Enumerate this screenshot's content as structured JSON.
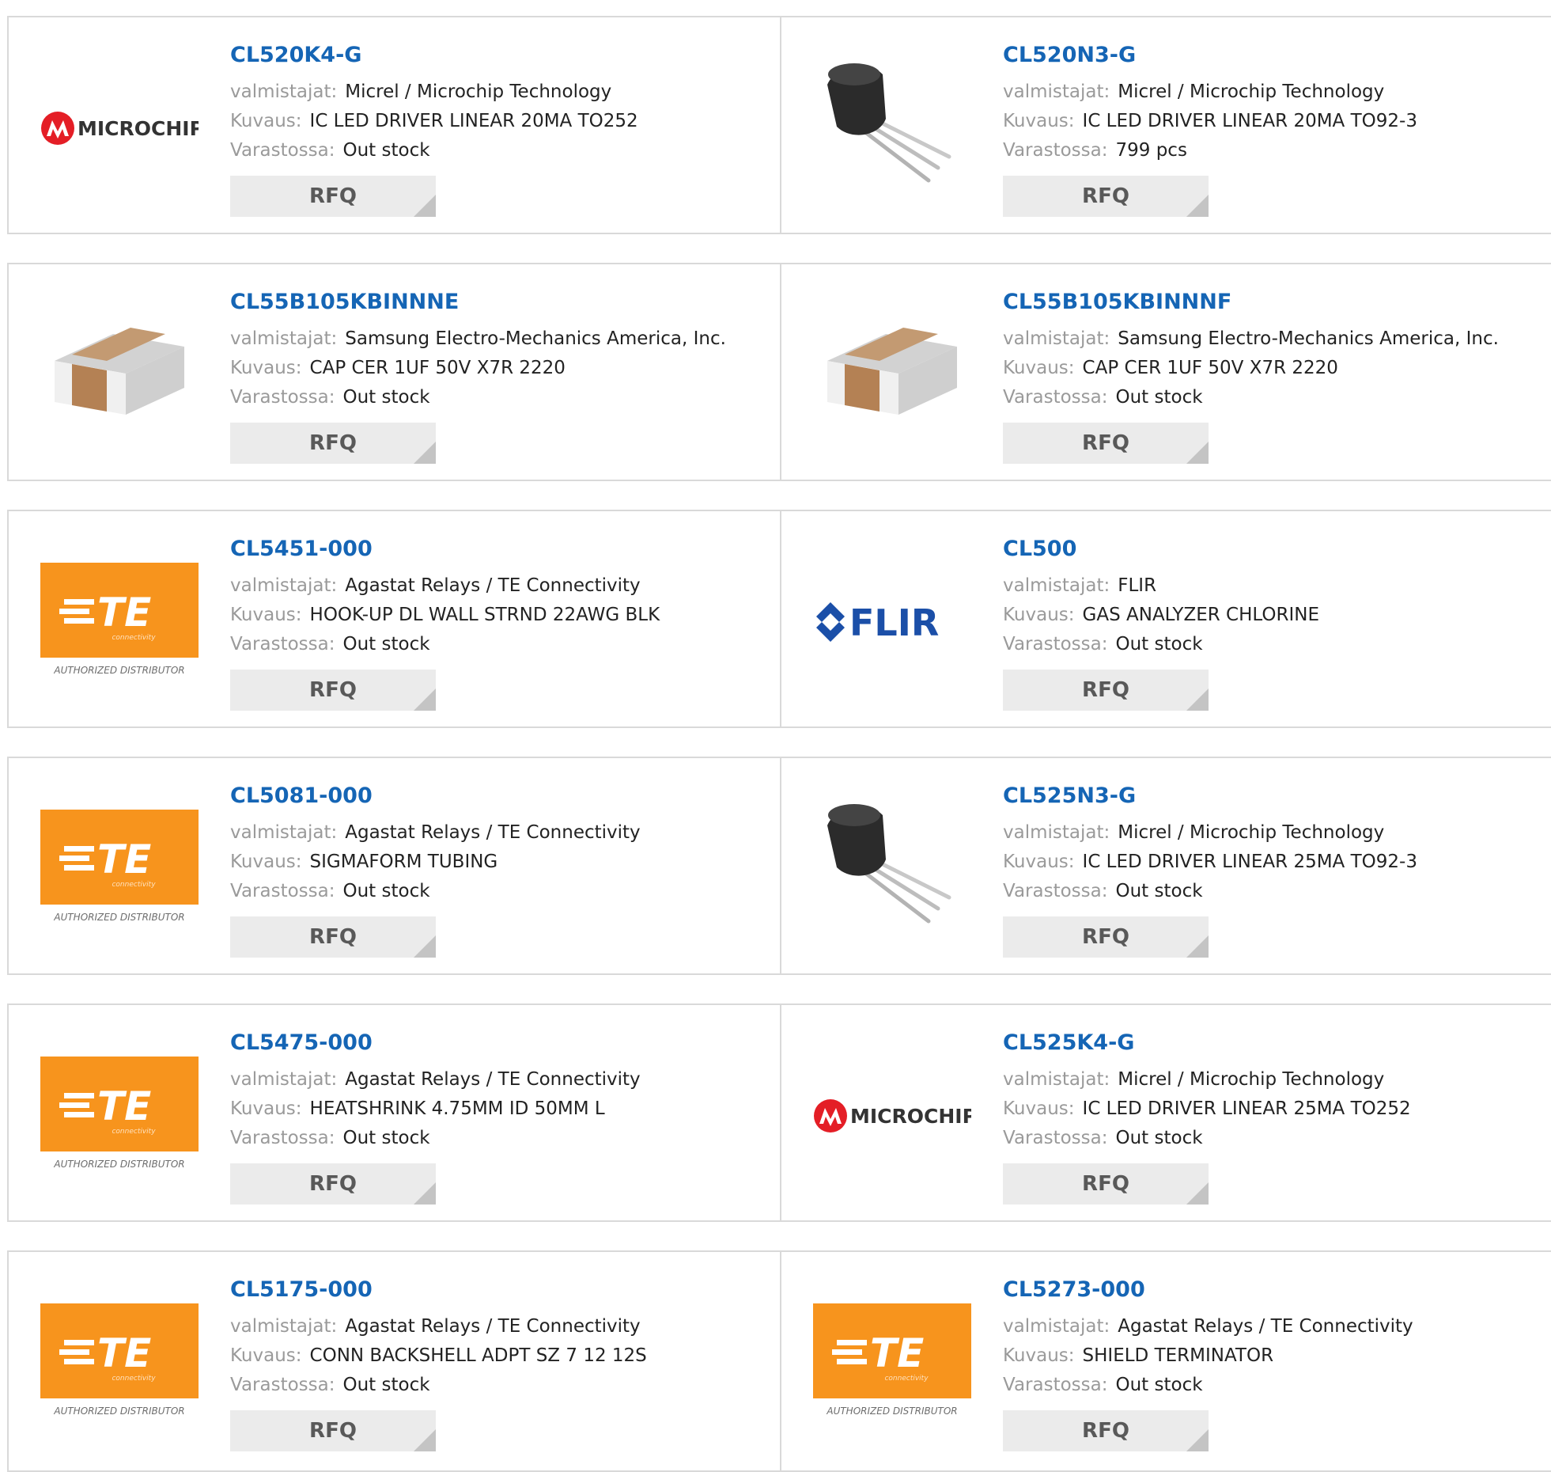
{
  "labels": {
    "manufacturer": "valmistajat:",
    "description": "Kuvaus:",
    "stock": "Varastossa:",
    "rfq": "RFQ"
  },
  "colors": {
    "part_link": "#1565b5",
    "te_orange": "#f7941d",
    "flir_blue": "#1b4fa8",
    "microchip_red": "#e41e26"
  },
  "logo_text": {
    "microchip": "MICROCHIP",
    "te": "TE",
    "te_sub": "connectivity",
    "te_auth": "AUTHORIZED DISTRIBUTOR",
    "flir": "FLIR"
  },
  "products": [
    {
      "part": "CL520K4-G",
      "manufacturer": "Micrel / Microchip Technology",
      "description": "IC LED DRIVER LINEAR 20MA TO252",
      "stock": "Out stock",
      "image": "microchip-logo"
    },
    {
      "part": "CL520N3-G",
      "manufacturer": "Micrel / Microchip Technology",
      "description": "IC LED DRIVER LINEAR 20MA TO92-3",
      "stock": "799 pcs",
      "image": "to92-transistor"
    },
    {
      "part": "CL55B105KBINNNE",
      "manufacturer": "Samsung Electro-Mechanics America, Inc.",
      "description": "CAP CER 1UF 50V X7R 2220",
      "stock": "Out stock",
      "image": "smd-capacitor"
    },
    {
      "part": "CL55B105KBINNNF",
      "manufacturer": "Samsung Electro-Mechanics America, Inc.",
      "description": "CAP CER 1UF 50V X7R 2220",
      "stock": "Out stock",
      "image": "smd-capacitor"
    },
    {
      "part": "CL5451-000",
      "manufacturer": "Agastat Relays / TE Connectivity",
      "description": "HOOK-UP DL WALL STRND 22AWG BLK",
      "stock": "Out stock",
      "image": "te-logo"
    },
    {
      "part": "CL500",
      "manufacturer": "FLIR",
      "description": "GAS ANALYZER CHLORINE",
      "stock": "Out stock",
      "image": "flir-logo"
    },
    {
      "part": "CL5081-000",
      "manufacturer": "Agastat Relays / TE Connectivity",
      "description": "SIGMAFORM TUBING",
      "stock": "Out stock",
      "image": "te-logo"
    },
    {
      "part": "CL525N3-G",
      "manufacturer": "Micrel / Microchip Technology",
      "description": "IC LED DRIVER LINEAR 25MA TO92-3",
      "stock": "Out stock",
      "image": "to92-transistor"
    },
    {
      "part": "CL5475-000",
      "manufacturer": "Agastat Relays / TE Connectivity",
      "description": "HEATSHRINK 4.75MM ID 50MM L",
      "stock": "Out stock",
      "image": "te-logo"
    },
    {
      "part": "CL525K4-G",
      "manufacturer": "Micrel / Microchip Technology",
      "description": "IC LED DRIVER LINEAR 25MA TO252",
      "stock": "Out stock",
      "image": "microchip-logo"
    },
    {
      "part": "CL5175-000",
      "manufacturer": "Agastat Relays / TE Connectivity",
      "description": "CONN BACKSHELL ADPT SZ 7 12 12S",
      "stock": "Out stock",
      "image": "te-logo"
    },
    {
      "part": "CL5273-000",
      "manufacturer": "Agastat Relays / TE Connectivity",
      "description": "SHIELD TERMINATOR",
      "stock": "Out stock",
      "image": "te-logo"
    }
  ]
}
